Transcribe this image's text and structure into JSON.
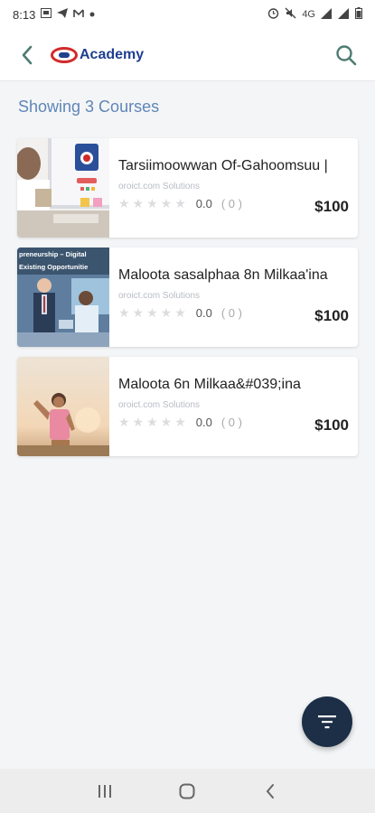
{
  "status_bar": {
    "time": "8:13",
    "left_icons": [
      "gallery-icon",
      "telegram-icon",
      "gmail-icon",
      "dot-icon"
    ],
    "right_icons": [
      "alarm-icon",
      "mute-icon",
      "4g-icon",
      "signal-icon",
      "battery-icon"
    ],
    "network": "4G"
  },
  "app_bar": {
    "logo_text": "Academy"
  },
  "main": {
    "showing_text": "Showing 3 Courses",
    "courses": [
      {
        "title": "Tarsiimoowwan Of-Gahoomsuu |",
        "instructor": "oroict.com Solutions",
        "stars": "★★★★★",
        "rating": "0.0",
        "rating_count": "( 0 )",
        "price": "$100"
      },
      {
        "title": "Maloota sasalphaa 8n Milkaa'ina",
        "instructor": "oroict.com Solutions",
        "stars": "★★★★★",
        "rating": "0.0",
        "rating_count": "( 0 )",
        "price": "$100",
        "thumb_text_1": "preneurship – Digital",
        "thumb_text_2": "Existing Opportunitie"
      },
      {
        "title": "Maloota 6n Milkaa&#039;ina",
        "instructor": "oroict.com Solutions",
        "stars": "★★★★★",
        "rating": "0.0",
        "rating_count": "( 0 )",
        "price": "$100"
      }
    ]
  },
  "colors": {
    "accent": "#5f86b8",
    "fab": "#1c2f47",
    "logo_blue": "#1f3f8f",
    "logo_red": "#d22a2a"
  }
}
